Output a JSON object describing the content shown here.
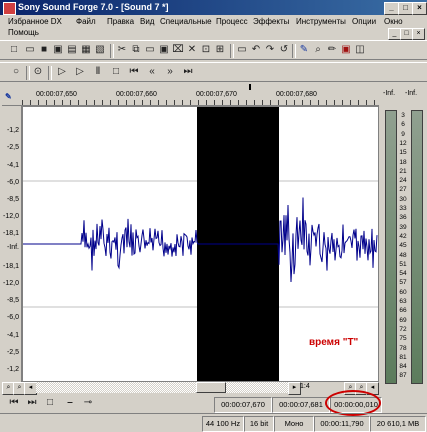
{
  "window": {
    "title": "Sony Sound Forge 7.0 - [Sound 7 *]",
    "controls": [
      "_",
      "□",
      "×"
    ]
  },
  "menu": [
    "Избранное DX",
    "Файл",
    "Правка",
    "Вид",
    "Специальные",
    "Процесс",
    "Эффекты",
    "Инструменты",
    "Опции",
    "Окно",
    "Помощь"
  ],
  "ruler": {
    "ticks": [
      "00:00:07,650",
      "00:00:07,660",
      "00:00:07,670",
      "00:00:07,680"
    ]
  },
  "scale": [
    "-1,2",
    "-2,5",
    "-4,1",
    "-6,0",
    "-8,5",
    "-12,0",
    "-18,1",
    "-Inf.",
    "-18,1",
    "-12,0",
    "-8,5",
    "-6,0",
    "-4,1",
    "-2,5",
    "-1,2"
  ],
  "meters": {
    "header_left": "-Inf.",
    "header_right": "-Inf.",
    "labels": [
      "3",
      "6",
      "9",
      "12",
      "15",
      "18",
      "21",
      "24",
      "27",
      "30",
      "33",
      "36",
      "39",
      "42",
      "45",
      "48",
      "51",
      "54",
      "57",
      "60",
      "63",
      "66",
      "69",
      "72",
      "75",
      "78",
      "81",
      "84",
      "87"
    ]
  },
  "scroll": {
    "zoom": "1:4"
  },
  "transport": {
    "sel_start": "00:00:07,670",
    "sel_end": "00:00:07,681",
    "sel_length": "00:00:00,010"
  },
  "status": {
    "samplerate": "44 100 Hz",
    "bits": "16 bit",
    "channels": "Моно",
    "length": "00:00:11,790",
    "disk": "20 610,1 MB"
  },
  "annotation": "время \"T\"",
  "colors": {
    "waveform": "#00008b",
    "selection": "#000000",
    "annotation": "#cc0000"
  }
}
